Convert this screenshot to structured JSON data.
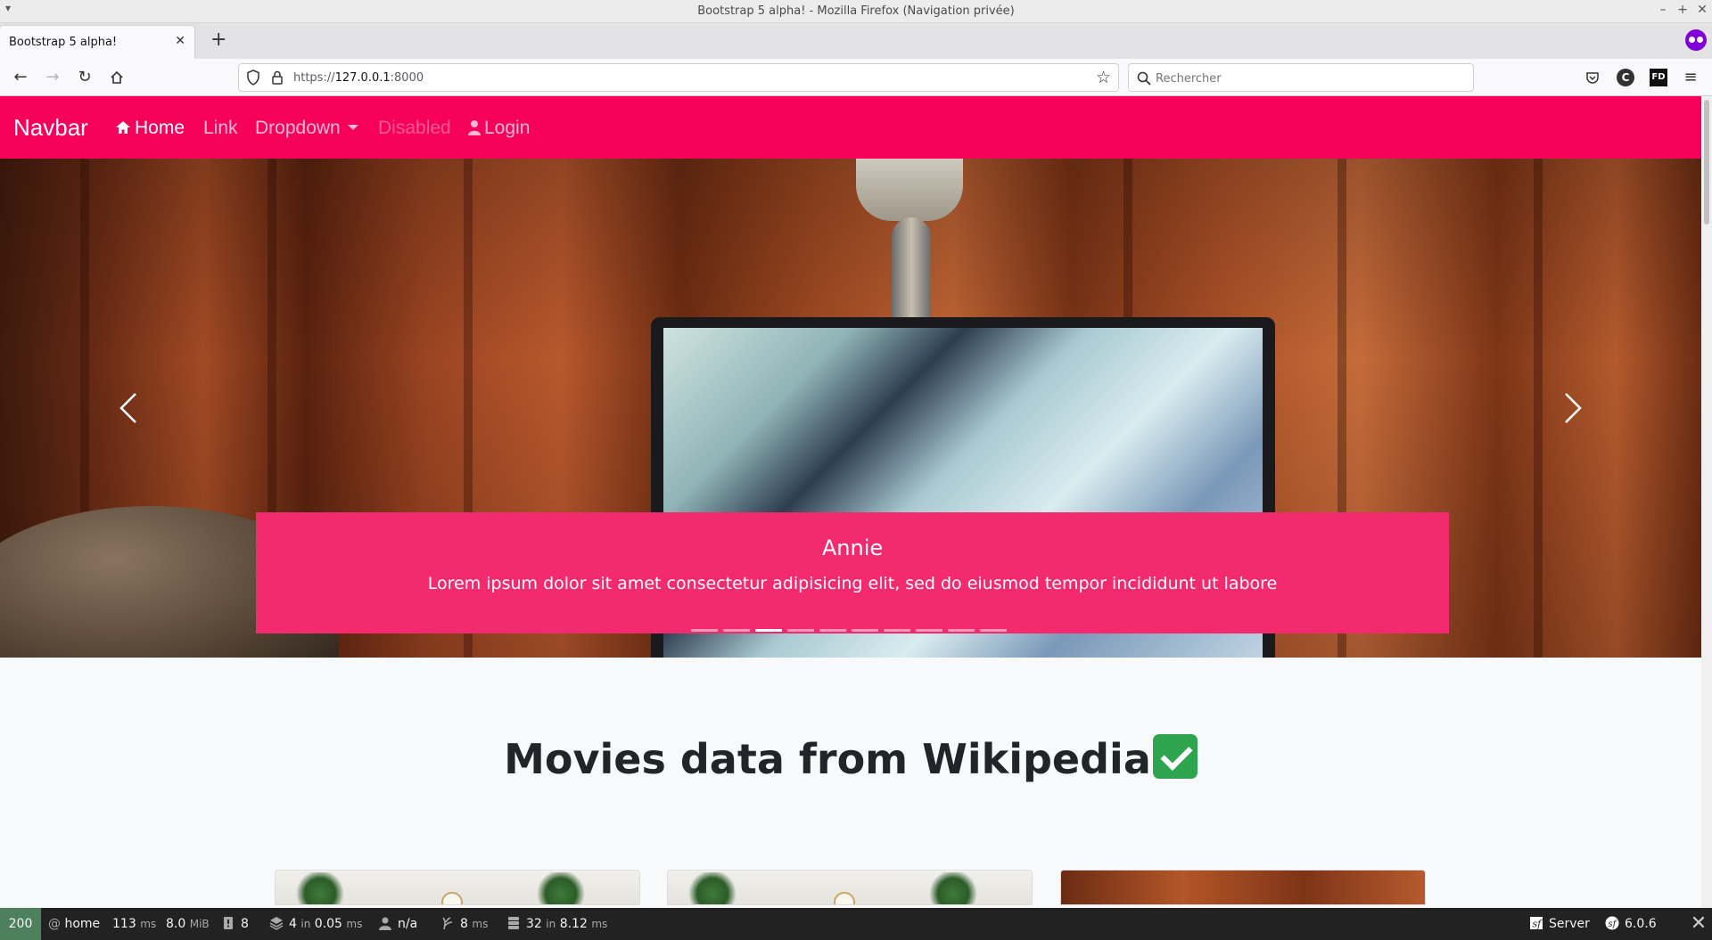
{
  "window": {
    "title": "Bootstrap 5 alpha! - Mozilla Firefox (Navigation privée)"
  },
  "tabs": [
    {
      "label": "Bootstrap 5 alpha!"
    }
  ],
  "toolbar": {
    "url_prefix": "https://",
    "url_host": "127.0.0.1",
    "url_port": ":8000",
    "search_placeholder": "Rechercher"
  },
  "navbar": {
    "brand": "Navbar",
    "items": [
      {
        "label": "Home",
        "icon": "home-icon",
        "state": "active"
      },
      {
        "label": "Link",
        "state": "normal"
      },
      {
        "label": "Dropdown",
        "state": "normal",
        "has_caret": true
      },
      {
        "label": "Disabled",
        "state": "disabled"
      },
      {
        "label": "Login",
        "icon": "user-icon",
        "state": "normal"
      }
    ],
    "background": "#f7005b"
  },
  "carousel": {
    "caption_title": "Annie",
    "caption_text": "Lorem ipsum dolor sit amet consectetur adipisicing elit, sed do eiusmod tempor incididunt ut labore",
    "caption_bg": "#f32a6d",
    "indicator_count": 10,
    "active_index": 2
  },
  "main": {
    "heading": "Movies data from Wikipedia",
    "heading_emoji": "check-mark-button-icon"
  },
  "debug_toolbar": {
    "status_code": "200",
    "route": "home",
    "time_value": "113",
    "time_unit": "ms",
    "memory_value": "8.0",
    "memory_unit": "MiB",
    "logs": "8",
    "cache_value": "4",
    "cache_in": "in",
    "cache_time": "0.05",
    "cache_unit": "ms",
    "user": "n/a",
    "twig_value": "8",
    "twig_unit": "ms",
    "db_value": "32",
    "db_in": "in",
    "db_time": "8.12",
    "db_unit": "ms",
    "server_label": "Server",
    "sf_version": "6.0.6"
  }
}
